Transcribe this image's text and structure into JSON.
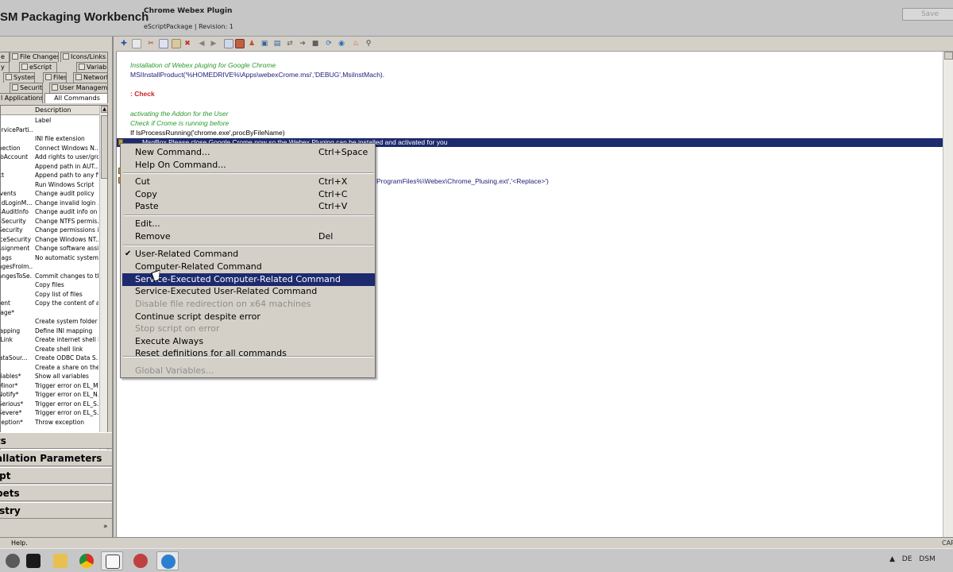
{
  "app": {
    "title": "SM Packaging Workbench",
    "package_name": "Chrome Webex Plugin",
    "package_info": "eScriptPackage | Revision: 1",
    "save_button": "Save"
  },
  "left_panel": {
    "tabs_row1": [
      "e",
      "File Changes",
      "Icons/Links"
    ],
    "tabs_row2": [
      "y",
      "eScript",
      "Variables"
    ],
    "tabs_row3": [
      "",
      "System",
      "Files",
      "Network"
    ],
    "tabs_row4": [
      "",
      "Security",
      "User Management"
    ],
    "tabs_row5": [
      "l Applications",
      "All Commands"
    ],
    "list_headers": {
      "col1": "",
      "col2": "Description"
    },
    "commands": [
      [
        "",
        "Label"
      ],
      [
        "serviceParti...",
        ""
      ],
      [
        "",
        "INI file extension"
      ],
      [
        "nnection",
        "Connect Windows N..."
      ],
      [
        "sToAccount",
        "Add rights to user/gro..."
      ],
      [
        "n",
        "Append path in AUT..."
      ],
      [
        "Ext",
        "Append path to any file"
      ],
      [
        "",
        "Run Windows Script"
      ],
      [
        "lEvents",
        "Change audit policy"
      ],
      [
        "alidLoginM...",
        "Change invalid login ..."
      ],
      [
        "FSAuditInfo",
        "Change audit info on ..."
      ],
      [
        "FSSecurity",
        "Change NTFS permis..."
      ],
      [
        "gSecurity",
        "Change permissions i..."
      ],
      [
        "viceSecurity",
        "Change Windows NT..."
      ],
      [
        "Assignment",
        "Change software assi..."
      ],
      [
        "lFlags",
        "No automatic system ..."
      ],
      [
        "angesFroIm...",
        ""
      ],
      [
        "hangesToSe...",
        "Commit changes to th..."
      ],
      [
        "",
        "Copy files"
      ],
      [
        "",
        "Copy list of files"
      ],
      [
        "ntent",
        "Copy the content of a..."
      ],
      [
        "mage*",
        ""
      ],
      [
        "er",
        "Create system folder"
      ],
      [
        "Mapping",
        "Define INI mapping"
      ],
      [
        "etLink",
        "Create internet shell link"
      ],
      [
        "",
        "Create shell link"
      ],
      [
        "DataSour...",
        "Create ODBC Data S..."
      ],
      [
        "e",
        "Create a share on the..."
      ],
      [
        "ariables*",
        "Show all variables"
      ],
      [
        "eMinor*",
        "Trigger error on EL_M..."
      ],
      [
        "eNotify*",
        "Trigger error on EL_N..."
      ],
      [
        "eSerious*",
        "Trigger error on EL_S..."
      ],
      [
        "eSevere*",
        "Trigger error on EL_S..."
      ],
      [
        "xception*",
        "Throw exception"
      ]
    ],
    "nav_sections": [
      "ts",
      "allation Parameters",
      "ipt",
      "pets",
      "istry"
    ]
  },
  "editor": {
    "lines": [
      {
        "kind": "comment",
        "text": "Installation of Webex pluging for Google Chrome"
      },
      {
        "kind": "code",
        "text": "MSIInstallProduct('%HOMEDRIVE%\\Apps\\webexCrome.msi','DEBUG',MsiInstMach)."
      },
      {
        "kind": "label",
        "text": ": Check"
      },
      {
        "kind": "comment",
        "text": "activating the Addon for the User"
      },
      {
        "kind": "comment",
        "text": "Check if Crome is running before"
      },
      {
        "kind": "plain",
        "text": "If IsProcessRunning('chrome.exe',procByFileName)"
      },
      {
        "kind": "selected",
        "text": "MsgBox Please close Google Crome now so the Webex Pluging can be installed and activated for you"
      },
      {
        "kind": "code",
        "text": "ProgramFiles%\\Webex\\Chrome_Plusing.ext','<Replace>')"
      }
    ]
  },
  "context_menu": {
    "items": [
      {
        "label": "New Command...",
        "shortcut": "Ctrl+Space"
      },
      {
        "label": "Help On Command...",
        "shortcut": ""
      },
      {
        "label": "Cut",
        "shortcut": "Ctrl+X"
      },
      {
        "label": "Copy",
        "shortcut": "Ctrl+C"
      },
      {
        "label": "Paste",
        "shortcut": "Ctrl+V"
      },
      {
        "label": "Edit...",
        "shortcut": ""
      },
      {
        "label": "Remove",
        "shortcut": "Del"
      },
      {
        "label": "User-Related Command",
        "shortcut": "",
        "checked": true
      },
      {
        "label": "Computer-Related Command",
        "shortcut": ""
      },
      {
        "label": "Service-Executed Computer-Related Command",
        "shortcut": "",
        "highlighted": true
      },
      {
        "label": "Service-Executed User-Related Command",
        "shortcut": ""
      },
      {
        "label": "Disable file redirection on x64 machines",
        "shortcut": "",
        "disabled": true
      },
      {
        "label": "Continue script despite error",
        "shortcut": ""
      },
      {
        "label": "Stop script on error",
        "shortcut": "",
        "disabled": true
      },
      {
        "label": "Execute Always",
        "shortcut": ""
      },
      {
        "label": "Reset definitions for all commands",
        "shortcut": ""
      },
      {
        "label": "Global Variables...",
        "shortcut": "",
        "disabled": true
      }
    ]
  },
  "status_bar": {
    "text": "Help.",
    "right": "CAP"
  },
  "taskbar": {
    "tray": [
      "DE",
      "DSM"
    ]
  },
  "colors": {
    "selection": "#1e2a6e",
    "comment": "#2a9a2a",
    "code": "#1c1c7a",
    "label": "#cc2222"
  }
}
